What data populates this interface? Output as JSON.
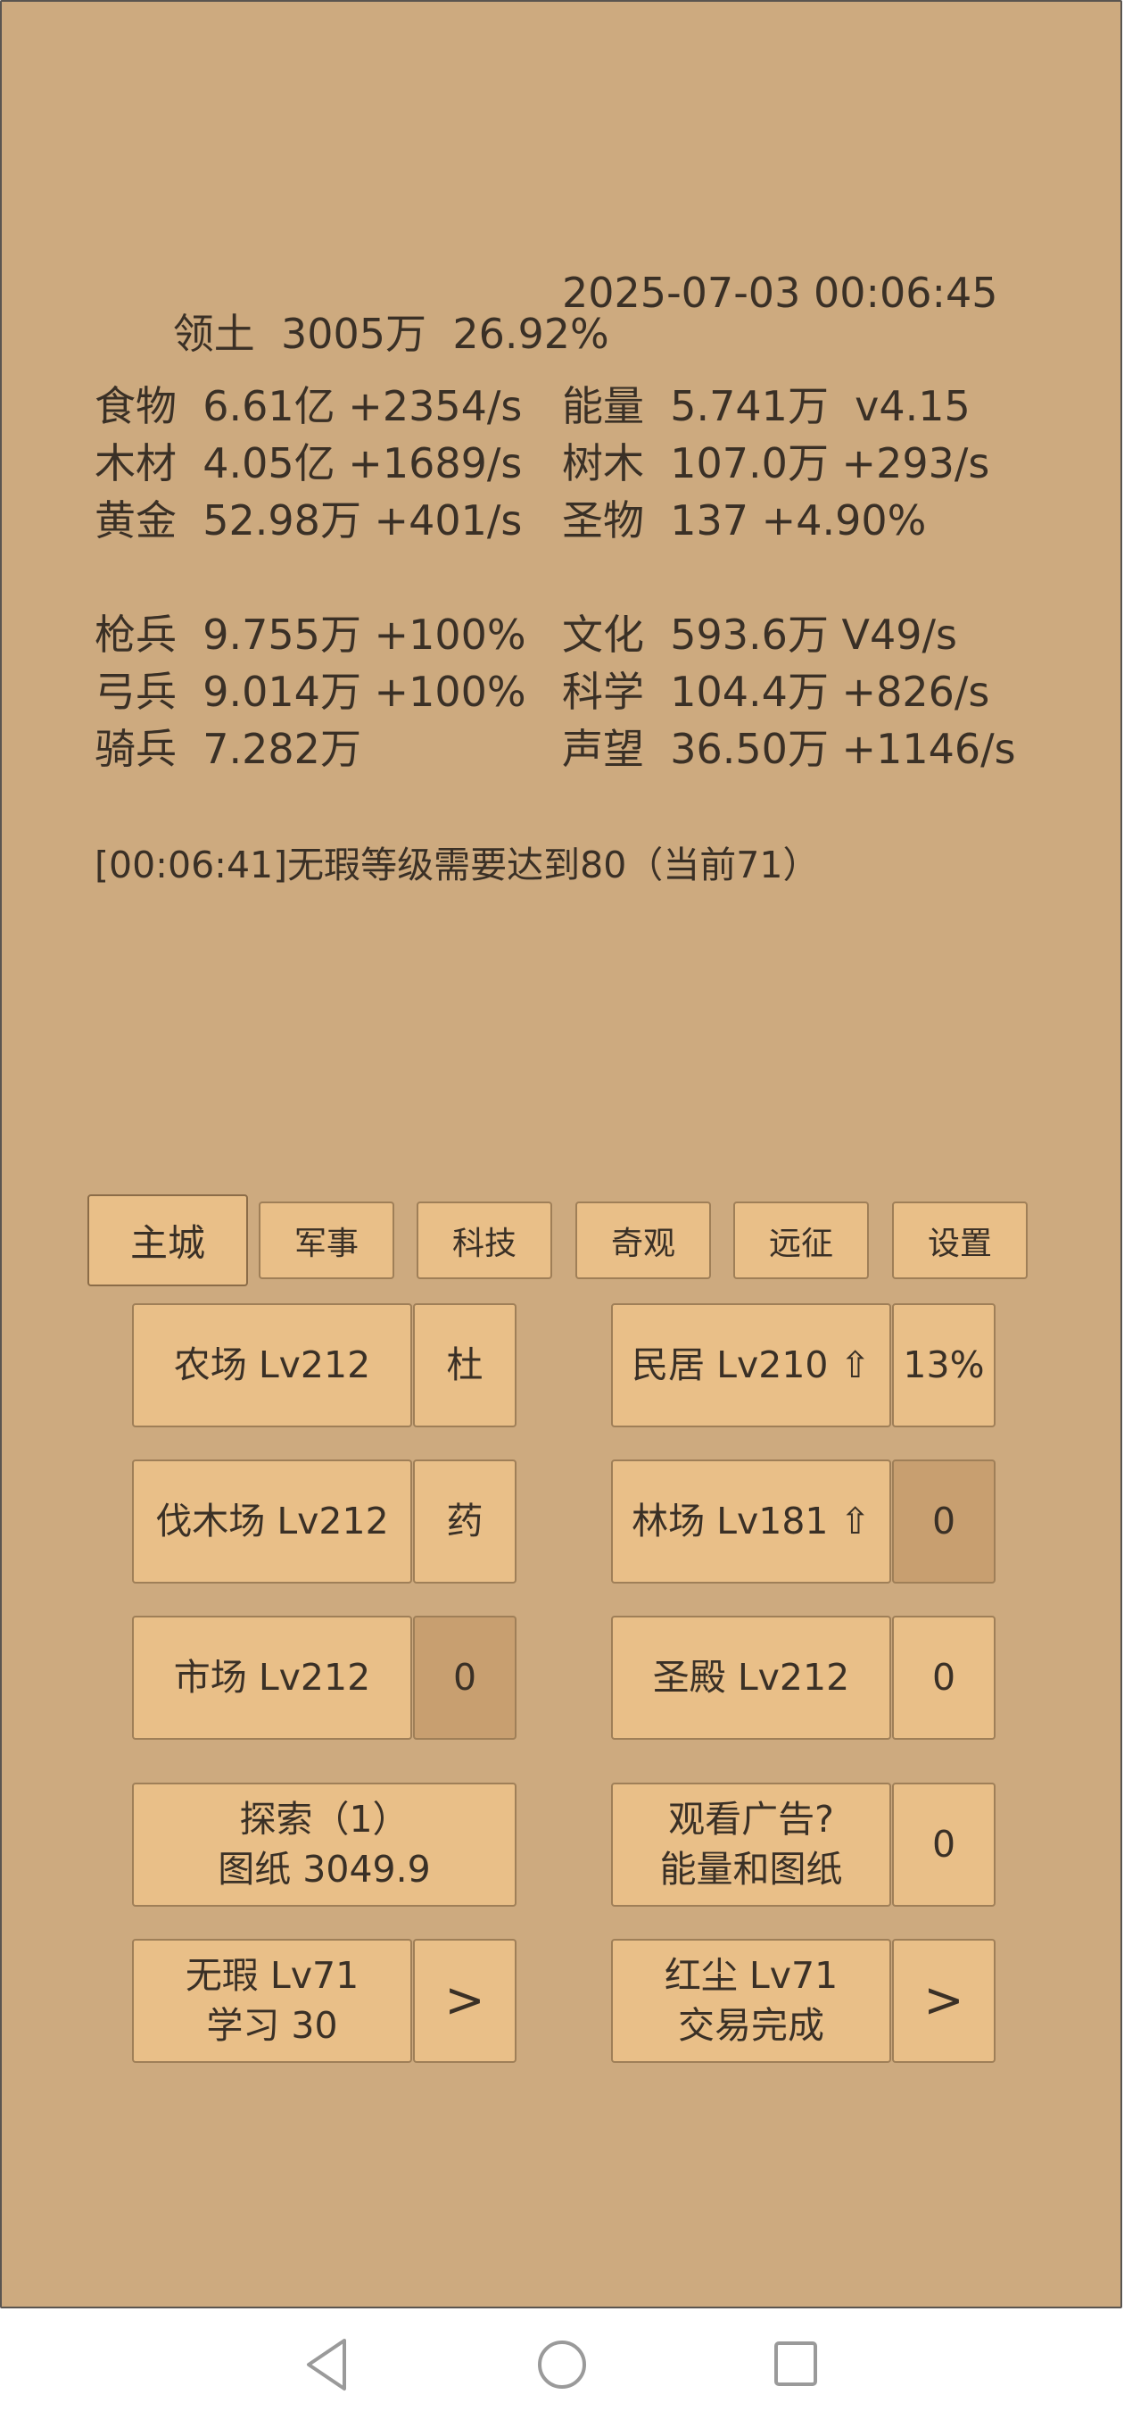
{
  "stats": {
    "territory": {
      "label": "领土",
      "value": "3005万",
      "pct": "26.92%"
    },
    "datetime": "2025-07-03 00:06:45",
    "left": [
      {
        "label": "食物",
        "value": "6.61亿 +2354/s"
      },
      {
        "label": "木材",
        "value": "4.05亿 +1689/s"
      },
      {
        "label": "黄金",
        "value": "52.98万 +401/s"
      }
    ],
    "right": [
      {
        "label": "能量",
        "value": "5.741万  v4.15"
      },
      {
        "label": "树木",
        "value": "107.0万 +293/s"
      },
      {
        "label": "圣物",
        "value": "137 +4.90%"
      }
    ],
    "left2": [
      {
        "label": "枪兵",
        "value": "9.755万 +100%"
      },
      {
        "label": "弓兵",
        "value": "9.014万 +100%"
      },
      {
        "label": "骑兵",
        "value": "7.282万"
      }
    ],
    "right2": [
      {
        "label": "文化",
        "value": "593.6万 V49/s"
      },
      {
        "label": "科学",
        "value": "104.4万 +826/s"
      },
      {
        "label": "声望",
        "value": "36.50万 +1146/s"
      }
    ]
  },
  "log": "[00:06:41]无瑕等级需要达到80（当前71）",
  "tabs": [
    "主城",
    "军事",
    "科技",
    "奇观",
    "远征",
    "设置"
  ],
  "buttons": {
    "farm": "农场 Lv212",
    "farm_side": "杜",
    "house": "民居 Lv210 ⇧",
    "house_side": "13%",
    "lumber": "伐木场 Lv212",
    "lumber_side": "药",
    "forest": "林场 Lv181 ⇧",
    "forest_side": "0",
    "market": "市场 Lv212",
    "market_side": "0",
    "temple": "圣殿 Lv212",
    "temple_side": "0",
    "explore_line1": "探索（1）",
    "explore_line2": "图纸 3049.9",
    "ad_line1": "观看广告?",
    "ad_line2": "能量和图纸",
    "ad_side": "0",
    "flawless_line1": "无瑕 Lv71",
    "flawless_line2": "学习 30",
    "flawless_side": ">",
    "redust_line1": "红尘 Lv71",
    "redust_line2": "交易完成",
    "redust_side": ">"
  }
}
